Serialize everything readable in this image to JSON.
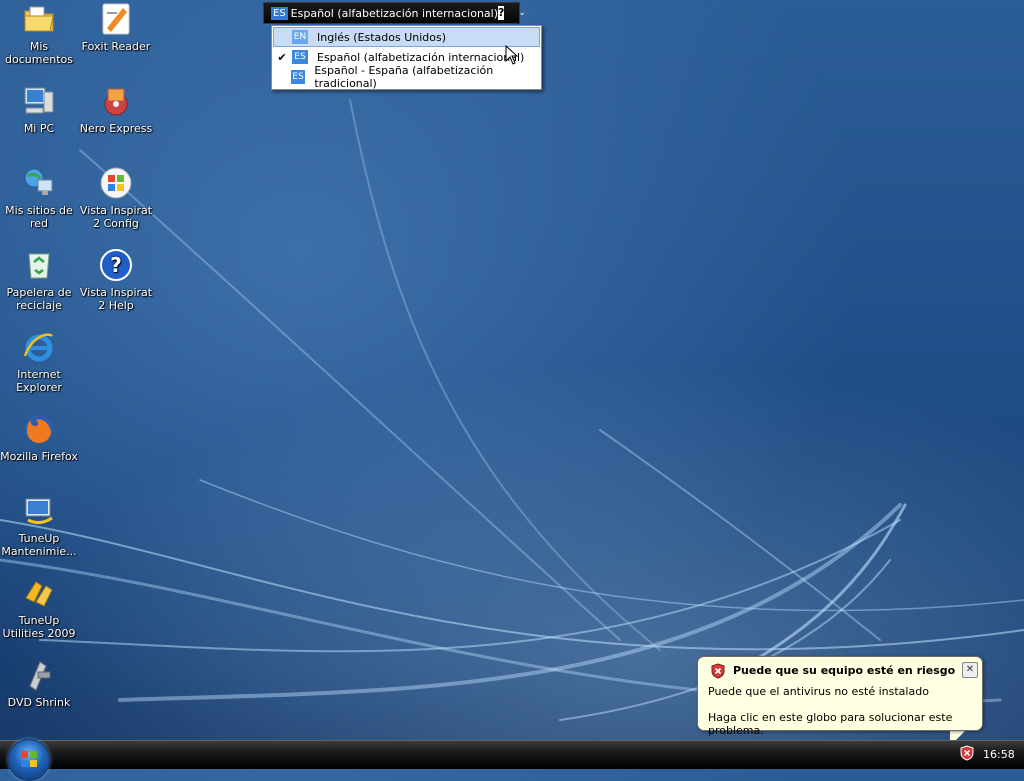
{
  "desktop": {
    "icons": [
      {
        "label": "Mis documentos",
        "icon": "folder-documents-icon"
      },
      {
        "label": "Foxit Reader",
        "icon": "foxit-reader-icon"
      },
      {
        "label": "Mi PC",
        "icon": "computer-icon"
      },
      {
        "label": "Nero Express",
        "icon": "nero-express-icon"
      },
      {
        "label": "Mis sitios de red",
        "icon": "network-places-icon"
      },
      {
        "label": "Vista Inspirat 2 Config",
        "icon": "windows-logo-icon"
      },
      {
        "label": "Papelera de reciclaje",
        "icon": "recycle-bin-icon"
      },
      {
        "label": "Vista Inspirat 2 Help",
        "icon": "help-icon"
      },
      {
        "label": "Internet Explorer",
        "icon": "internet-explorer-icon"
      },
      {
        "label": "Mozilla Firefox",
        "icon": "firefox-icon"
      },
      {
        "label": "TuneUp Mantenimie...",
        "icon": "tuneup-maintenance-icon"
      },
      {
        "label": "TuneUp Utilities 2009",
        "icon": "tuneup-utilities-icon"
      },
      {
        "label": "DVD Shrink",
        "icon": "dvd-shrink-icon"
      }
    ]
  },
  "language_bar": {
    "tag": "ES",
    "current": "Español (alfabetización internacional)",
    "help": "?",
    "menu_arrow": "⌄"
  },
  "language_menu": {
    "items": [
      {
        "tag": "EN",
        "label": "Inglés (Estados Unidos)",
        "checked": false,
        "highlighted": true
      },
      {
        "tag": "ES",
        "label": "Español (alfabetización internacional)",
        "checked": true,
        "highlighted": false
      },
      {
        "tag": "ES",
        "label": "Español - España (alfabetización tradicional)",
        "checked": false,
        "highlighted": false
      }
    ],
    "check_mark": "✔"
  },
  "balloon": {
    "title": "Puede que su equipo esté en riesgo",
    "line1": "Puede que el antivirus no esté instalado",
    "line2": "Haga clic en este globo para solucionar este problema.",
    "close": "✕"
  },
  "taskbar": {
    "clock": "16:58"
  },
  "colors": {
    "desktop_blue": "#1f4f88",
    "menu_highlight": "#c8dcf6",
    "balloon_bg": "#ffffe1",
    "tag_blue": "#3a88e0"
  }
}
